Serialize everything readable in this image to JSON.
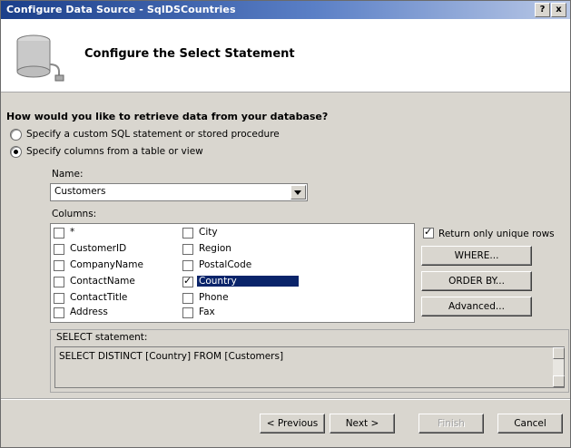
{
  "window": {
    "title": "Configure Data Source - SqlDSCountries",
    "help_label": "?",
    "close_label": "x"
  },
  "header": {
    "title": "Configure the Select Statement",
    "icon": "database-connection-icon"
  },
  "question": "How would you like to retrieve data from your database?",
  "options": [
    {
      "label": "Specify a custom SQL statement or stored procedure",
      "selected": false
    },
    {
      "label": "Specify columns from a table or view",
      "selected": true
    }
  ],
  "name_field": {
    "label": "Name:",
    "value": "Customers"
  },
  "columns": {
    "label": "Columns:",
    "items": [
      {
        "label": "*",
        "checked": false
      },
      {
        "label": "CustomerID",
        "checked": false
      },
      {
        "label": "CompanyName",
        "checked": false
      },
      {
        "label": "ContactName",
        "checked": false
      },
      {
        "label": "ContactTitle",
        "checked": false
      },
      {
        "label": "Address",
        "checked": false
      },
      {
        "label": "City",
        "checked": false
      },
      {
        "label": "Region",
        "checked": false
      },
      {
        "label": "PostalCode",
        "checked": false
      },
      {
        "label": "Country",
        "checked": true,
        "highlighted": true
      },
      {
        "label": "Phone",
        "checked": false
      },
      {
        "label": "Fax",
        "checked": false
      }
    ]
  },
  "unique_rows": {
    "label": "Return only unique rows",
    "checked": true
  },
  "side_buttons": {
    "where": "WHERE...",
    "order_by": "ORDER BY...",
    "advanced": "Advanced..."
  },
  "select_statement": {
    "label": "SELECT statement:",
    "value": "SELECT DISTINCT [Country] FROM [Customers]"
  },
  "footer": {
    "previous": "< Previous",
    "next": "Next >",
    "finish": "Finish",
    "cancel": "Cancel"
  },
  "colors": {
    "titlebar_start": "#1b3f8a",
    "dialog_bg": "#d9d6cf",
    "selection": "#0a246a"
  }
}
